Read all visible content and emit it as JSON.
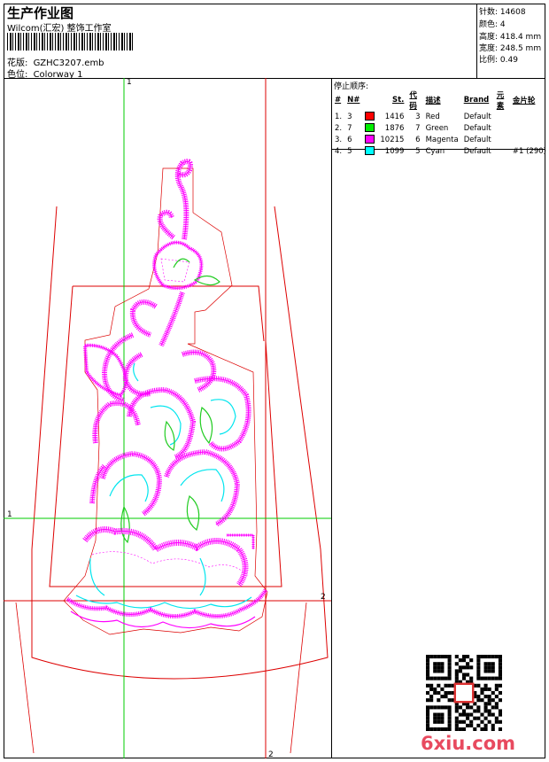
{
  "header": {
    "title": "生产作业图",
    "subtitle": "Wilcom(汇宏) 整饰工作室",
    "design_label": "花版:",
    "design_value": "GZHC3207.emb",
    "colorway_label": "色位:",
    "colorway_value": "Colorway 1"
  },
  "meta": [
    {
      "label": "针数:",
      "value": "14608"
    },
    {
      "label": "颜色:",
      "value": "4"
    },
    {
      "label": "高度:",
      "value": "418.4 mm"
    },
    {
      "label": "宽度:",
      "value": "248.5 mm"
    },
    {
      "label": "比例:",
      "value": "0.49"
    }
  ],
  "stop_sequence": {
    "title": "停止顺序:",
    "headers": [
      "#",
      "N#",
      "",
      "St.",
      "代码",
      "描述",
      "Brand",
      "元素",
      "金片轮"
    ],
    "rows": [
      {
        "num": "1.",
        "n": "3",
        "color": "#ff0000",
        "st": "1416",
        "code": "3",
        "desc": "Red",
        "brand": "Default",
        "element": "",
        "wheel": ""
      },
      {
        "num": "2.",
        "n": "7",
        "color": "#00ee00",
        "st": "1876",
        "code": "7",
        "desc": "Green",
        "brand": "Default",
        "element": "",
        "wheel": ""
      },
      {
        "num": "3.",
        "n": "6",
        "color": "#ff00ff",
        "st": "10215",
        "code": "6",
        "desc": "Magenta",
        "brand": "Default",
        "element": "",
        "wheel": ""
      },
      {
        "num": "4.",
        "n": "5",
        "color": "#00ffff",
        "st": "1099",
        "code": "5",
        "desc": "Cyan",
        "brand": "Default",
        "element": "",
        "wheel": "#1 (290)"
      }
    ]
  },
  "axes": {
    "label_1": "1",
    "label_2": "2"
  },
  "watermark": "6xiu.com",
  "colors": {
    "outline": "#dd0000",
    "axis": "#00cc00",
    "embroidery": "#ff00ff",
    "fill": "#00e5ee",
    "leaf": "#22cc22"
  }
}
